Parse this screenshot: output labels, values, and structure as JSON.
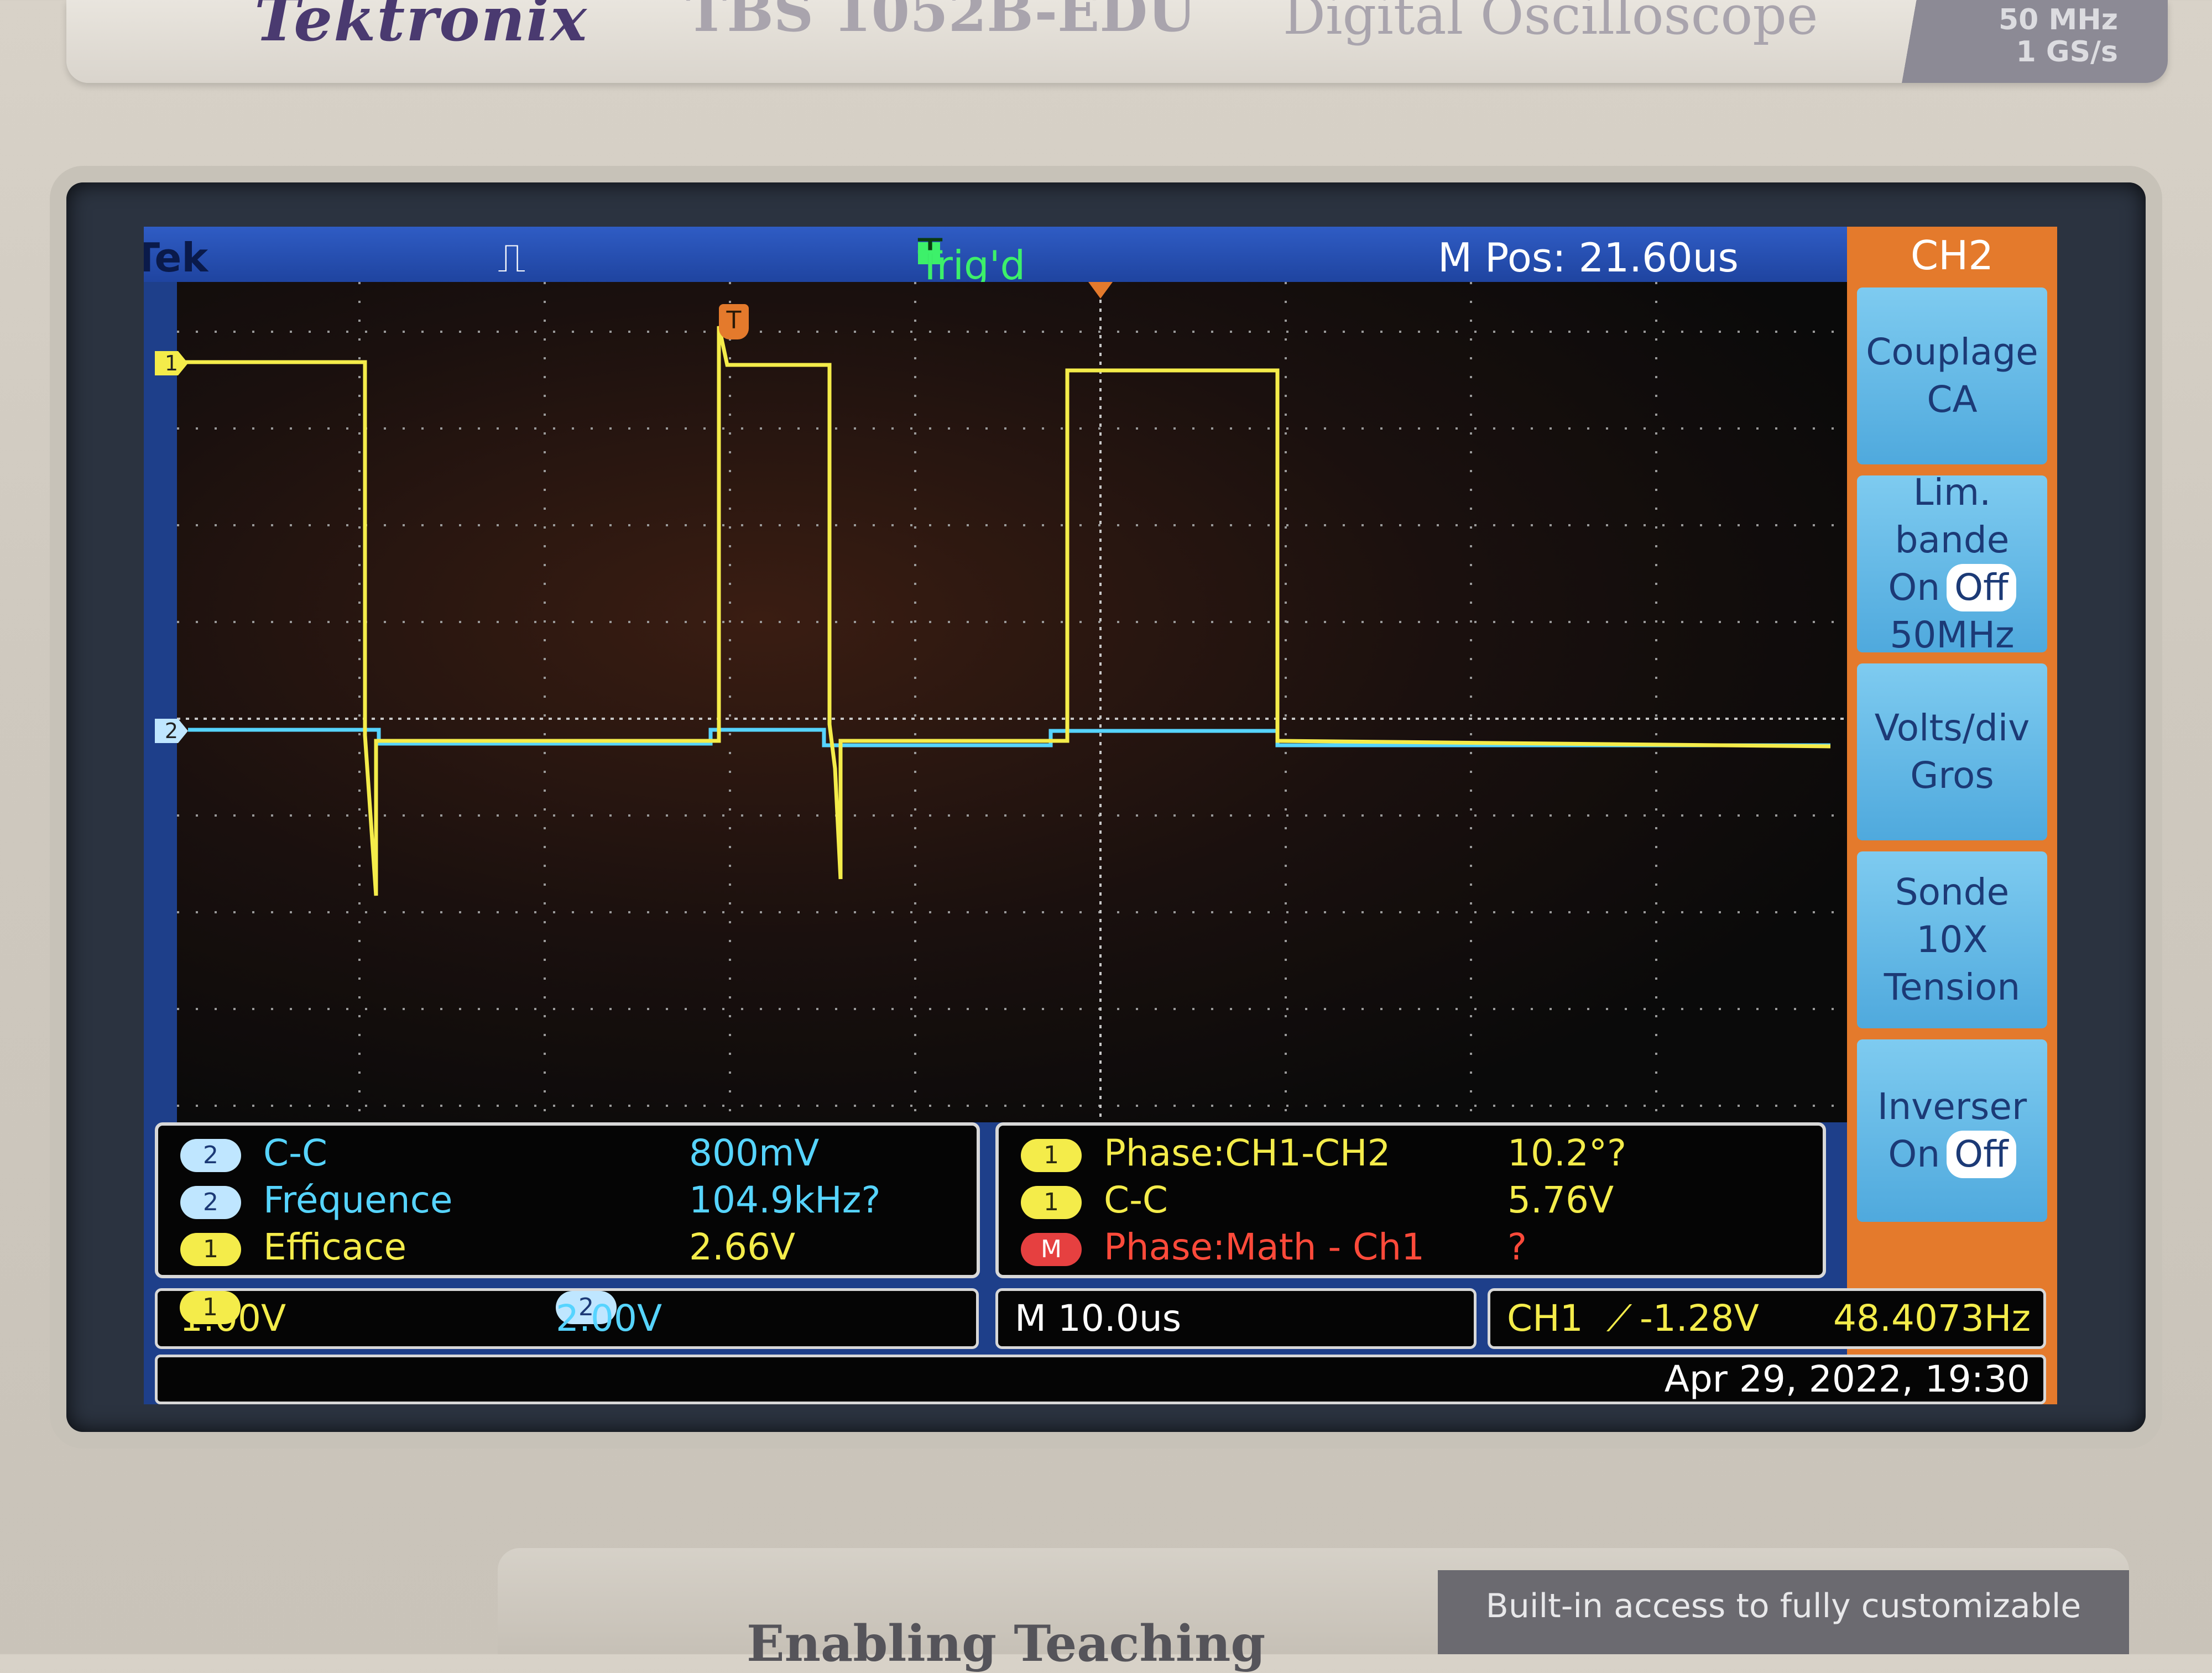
{
  "device": {
    "brand": "Tektronix",
    "model": "TBS 1052B-EDU",
    "description": "Digital Oscilloscope",
    "bandwidth": "50 MHz",
    "sample_rate": "1 GS/s"
  },
  "header": {
    "logo": "Tek",
    "trigger_status": "Trig'd",
    "trigger_icon": "T",
    "m_pos": "M Pos: 21.60us"
  },
  "markers": {
    "ch1": "1",
    "ch2": "2",
    "trigger": "T"
  },
  "menu": {
    "title": "CH2",
    "coupling": {
      "line1": "Couplage",
      "line2": "CA"
    },
    "bandwidth": {
      "line1": "Lim. bande",
      "on": "On",
      "off": "Off",
      "line3": "50MHz"
    },
    "volts_div": {
      "line1": "Volts/div",
      "line2": "Gros"
    },
    "probe": {
      "line1": "Sonde",
      "line2": "10X",
      "line3": "Tension"
    },
    "invert": {
      "line1": "Inverser",
      "on": "On",
      "off": "Off"
    }
  },
  "measurements_left": [
    {
      "ch": "2",
      "label": "C-C",
      "value": "800mV"
    },
    {
      "ch": "2",
      "label": "Fréquence",
      "value": "104.9kHz?"
    },
    {
      "ch": "1",
      "label": "Efficace",
      "value": "2.66V"
    }
  ],
  "measurements_right": [
    {
      "ch": "1",
      "label": "Phase:CH1-CH2",
      "value": "10.2°?"
    },
    {
      "ch": "1",
      "label": "C-C",
      "value": "5.76V"
    },
    {
      "ch": "M",
      "label": "Phase:Math - Ch1",
      "value": "?"
    }
  ],
  "status": {
    "ch1_badge": "1",
    "ch1_scale": "1.00V",
    "ch2_badge": "2",
    "ch2_scale": "2.00V",
    "timebase": "M 10.0us",
    "trigger_source": "CH1",
    "trigger_level": "-1.28V",
    "trigger_freq": "48.4073Hz",
    "datetime": "Apr 29, 2022, 19:30"
  },
  "bottom": {
    "left_text": "Enabling Teaching",
    "right_text": "Built-in access to fully customizable"
  },
  "colors": {
    "ch1": "#f4ec4a",
    "ch2": "#56d4ff",
    "menu_accent": "#e47a2c",
    "menu_button": "#6fbde8"
  }
}
